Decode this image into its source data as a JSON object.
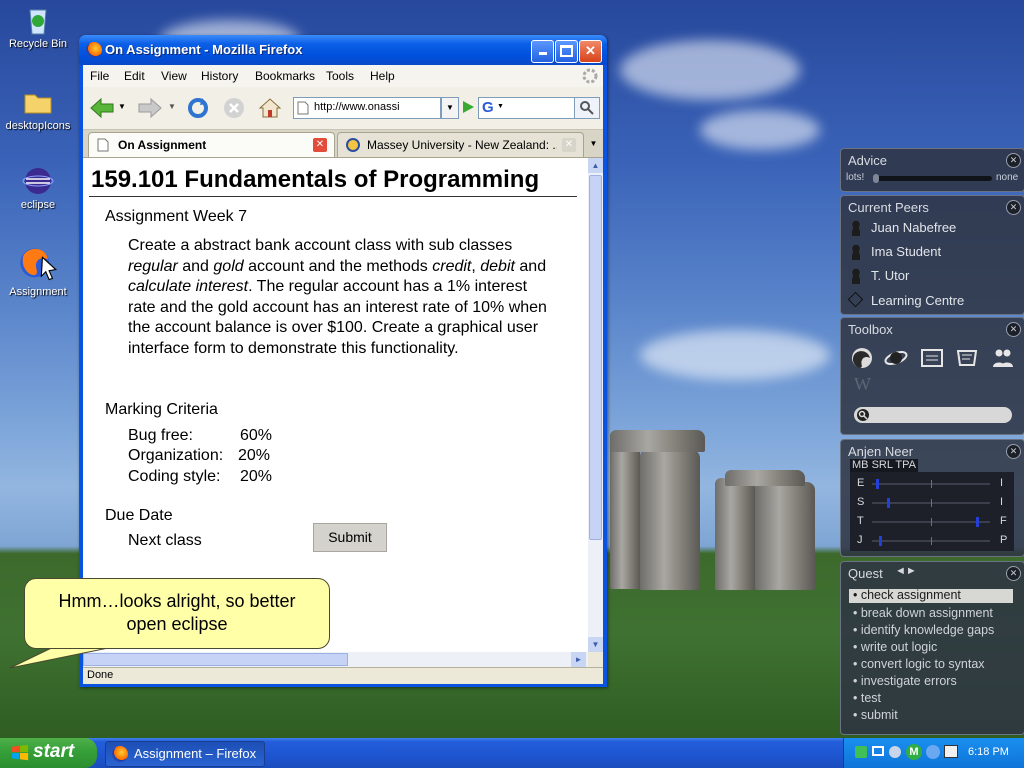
{
  "desktop": {
    "icons": [
      {
        "label": "Recycle Bin"
      },
      {
        "label": "desktopIcons"
      },
      {
        "label": "eclipse"
      },
      {
        "label": "Assignment"
      }
    ]
  },
  "window": {
    "title": "On Assignment - Mozilla Firefox",
    "menus": [
      "File",
      "Edit",
      "View",
      "History",
      "Bookmarks",
      "Tools",
      "Help"
    ],
    "url": "http://www.onassi",
    "search_glyph": "G",
    "tabs": [
      {
        "label": "On Assignment",
        "active": true
      },
      {
        "label": "Massey University - New Zealand: ...",
        "active": false
      }
    ],
    "status": "Done"
  },
  "page": {
    "heading": "159.101 Fundamentals of Programming",
    "section_assignment": "Assignment Week 7",
    "para": {
      "s1": "Create a abstract bank account class with sub classes ",
      "em1": "regular",
      "s2": " and ",
      "em2": "gold",
      "s3": " account and the methods ",
      "em3": "credit",
      "s4": ", ",
      "em4": "debit",
      "s5": " and ",
      "em5": "calculate interest",
      "s6": ". The regular account has a 1% interest rate and the gold account has an interest rate of 10% when the account balance is over $100. Create a graphical user interface form to demonstrate this functionality."
    },
    "section_marking": "Marking Criteria",
    "criteria": [
      {
        "name": "Bug free:",
        "value": "60%"
      },
      {
        "name": "Organization:",
        "value": "20%"
      },
      {
        "name": "Coding style:",
        "value": "20%"
      }
    ],
    "section_due": "Due Date",
    "due_value": "Next class",
    "submit_label": "Submit"
  },
  "advice": {
    "title": "Advice",
    "left_label": "lots!",
    "right_label": "none",
    "level": 0.0
  },
  "peers": {
    "title": "Current Peers",
    "items": [
      "Juan Nabefree",
      "Ima Student",
      "T. Utor",
      "Learning Centre"
    ]
  },
  "toolbox": {
    "title": "Toolbox",
    "icons": [
      "firefox-icon",
      "eclipse-icon",
      "calendar-icon",
      "notes-icon",
      "people-icon",
      "wikipedia-icon",
      "search-icon"
    ],
    "wiki_glyph": "W"
  },
  "profile": {
    "title": "Anjen Neer",
    "tabs": [
      "MB",
      "SRL",
      "TPA"
    ],
    "scales": [
      {
        "left": "E",
        "right": "I",
        "value": 0.03
      },
      {
        "left": "S",
        "right": "I",
        "value": 0.13
      },
      {
        "left": "T",
        "right": "F",
        "value": 0.88
      },
      {
        "left": "J",
        "right": "P",
        "value": 0.06
      }
    ]
  },
  "quest": {
    "title": "Quest",
    "nav": "◄►",
    "items": [
      "• check assignment",
      "• break down assignment",
      "• identify knowledge gaps",
      "• write out logic",
      "• convert logic to syntax",
      "• investigate errors",
      "• test",
      "• submit"
    ]
  },
  "taskbar": {
    "start": "start",
    "task": "Assignment – Firefox",
    "clock": "6:18 PM",
    "tray_letter": "M"
  },
  "bubble": {
    "text": "Hmm…looks alright, so better open eclipse"
  }
}
